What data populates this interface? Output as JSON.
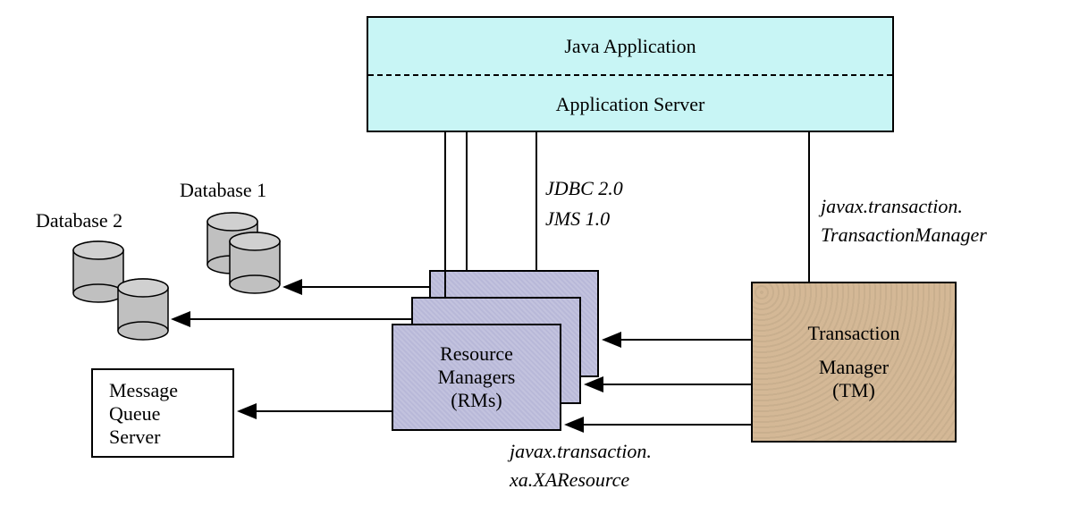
{
  "appBox": {
    "top": "Java Application",
    "bottom": "Application  Server"
  },
  "rmBox": {
    "line1": "Resource",
    "line2": "Managers",
    "line3": "(RMs)"
  },
  "tmBox": {
    "line1": "Transaction",
    "line2": "Manager",
    "line3": "(TM)"
  },
  "msgBox": {
    "line1": "Message",
    "line2": "Queue",
    "line3": "Server"
  },
  "labels": {
    "db1": "Database 1",
    "db2": "Database 2",
    "jdbc": "JDBC 2.0",
    "jms": "JMS 1.0",
    "jtm1": "javax.transaction.",
    "jtm2": "TransactionManager",
    "xa1": "javax.transaction.",
    "xa2": "xa.XAResource"
  }
}
